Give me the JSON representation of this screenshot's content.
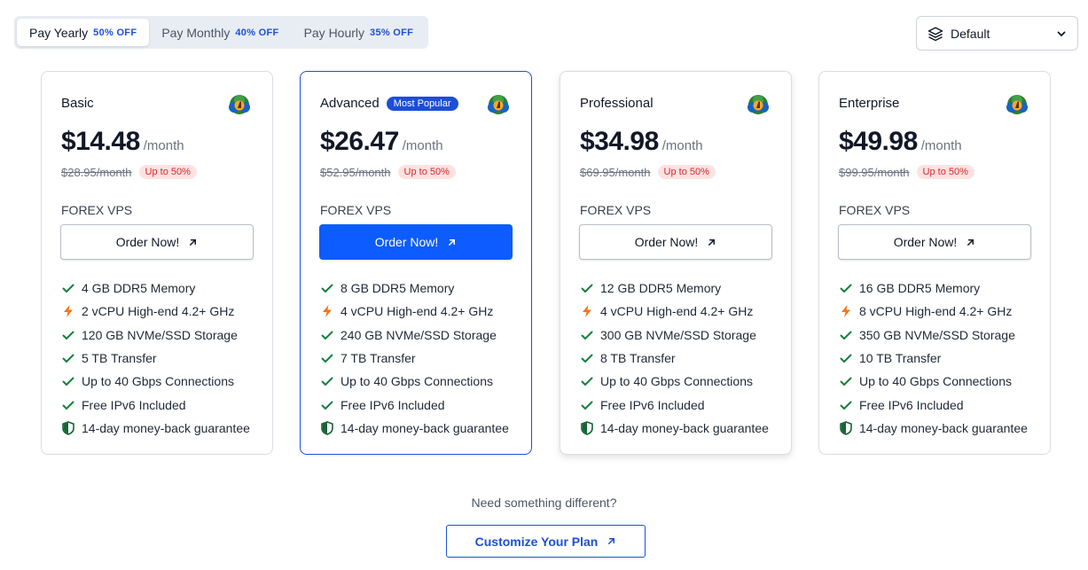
{
  "billing": {
    "options": [
      {
        "label": "Pay Yearly",
        "discount": "50% OFF"
      },
      {
        "label": "Pay Monthly",
        "discount": "40% OFF"
      },
      {
        "label": "Pay Hourly",
        "discount": "35% OFF"
      }
    ],
    "active_index": 0
  },
  "sort": {
    "selected": "Default",
    "icon": "layers-icon"
  },
  "accent_color": "#0d5cff",
  "plans": [
    {
      "name": "Basic",
      "badge": "",
      "price": "$14.48",
      "period": "/month",
      "old_price": "$28.95/month",
      "save_badge": "Up to 50%",
      "product": "FOREX VPS",
      "order_label": "Order Now!",
      "features": [
        "4 GB DDR5 Memory",
        "2 vCPU High-end 4.2+ GHz",
        "120 GB NVMe/SSD Storage",
        "5 TB Transfer",
        "Up to 40 Gbps Connections",
        "Free IPv6 Included",
        "14-day money-back guarantee"
      ]
    },
    {
      "name": "Advanced",
      "badge": "Most Popular",
      "price": "$26.47",
      "period": "/month",
      "old_price": "$52.95/month",
      "save_badge": "Up to 50%",
      "product": "FOREX VPS",
      "order_label": "Order Now!",
      "features": [
        "8 GB DDR5 Memory",
        "4 vCPU High-end 4.2+ GHz",
        "240 GB NVMe/SSD Storage",
        "7 TB Transfer",
        "Up to 40 Gbps Connections",
        "Free IPv6 Included",
        "14-day money-back guarantee"
      ]
    },
    {
      "name": "Professional",
      "badge": "",
      "price": "$34.98",
      "period": "/month",
      "old_price": "$69.95/month",
      "save_badge": "Up to 50%",
      "product": "FOREX VPS",
      "order_label": "Order Now!",
      "features": [
        "12 GB DDR5 Memory",
        "4 vCPU High-end 4.2+ GHz",
        "300 GB NVMe/SSD Storage",
        "8 TB Transfer",
        "Up to 40 Gbps Connections",
        "Free IPv6 Included",
        "14-day money-back guarantee"
      ]
    },
    {
      "name": "Enterprise",
      "badge": "",
      "price": "$49.98",
      "period": "/month",
      "old_price": "$99.95/month",
      "save_badge": "Up to 50%",
      "product": "FOREX VPS",
      "order_label": "Order Now!",
      "features": [
        "16 GB DDR5 Memory",
        "8 vCPU High-end 4.2+ GHz",
        "350 GB NVMe/SSD Storage",
        "10 TB Transfer",
        "Up to 40 Gbps Connections",
        "Free IPv6 Included",
        "14-day money-back guarantee"
      ]
    }
  ],
  "feature_icons": [
    "check-icon",
    "lightning-icon",
    "check-icon",
    "check-icon",
    "check-icon",
    "check-icon",
    "shield-icon"
  ],
  "footer": {
    "prompt": "Need something different?",
    "customize_label": "Customize Your Plan"
  }
}
